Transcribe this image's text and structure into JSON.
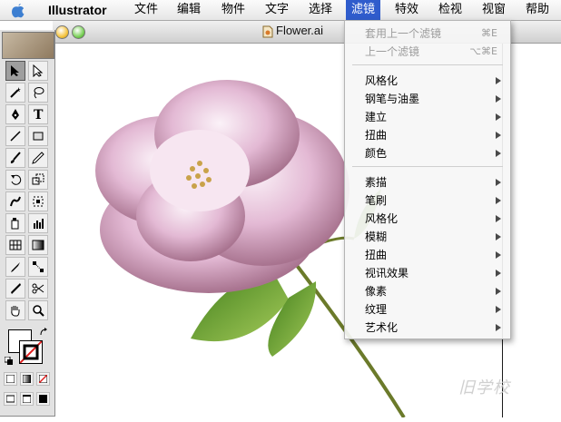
{
  "menubar": {
    "app_name": "Illustrator",
    "items": [
      "文件",
      "编辑",
      "物件",
      "文字",
      "选择",
      "滤镜",
      "特效",
      "检视",
      "视窗",
      "帮助"
    ],
    "active": "滤镜"
  },
  "document": {
    "title": "Flower.ai"
  },
  "filter_menu": {
    "top": [
      {
        "label": "套用上一个滤镜",
        "shortcut": "⌘E",
        "disabled": true
      },
      {
        "label": "上一个滤镜",
        "shortcut": "⌥⌘E",
        "disabled": true
      }
    ],
    "group1": [
      "风格化",
      "钢笔与油墨",
      "建立",
      "扭曲",
      "颜色"
    ],
    "group2": [
      "素描",
      "笔刷",
      "风格化",
      "模糊",
      "扭曲",
      "视讯效果",
      "像素",
      "纹理",
      "艺术化"
    ]
  },
  "toolbox": {
    "tools": [
      "selection-arrow",
      "direct-selection",
      "magic-wand",
      "lasso",
      "pen",
      "type",
      "line",
      "rectangle",
      "paintbrush",
      "pencil",
      "rotate",
      "scale",
      "warp",
      "free-transform",
      "symbol-sprayer",
      "graph",
      "mesh",
      "gradient",
      "eyedropper",
      "blend",
      "scissors-knife",
      "scissors",
      "hand",
      "zoom"
    ]
  },
  "colors": {
    "menu_highlight": "#2f5ccc",
    "flower_pink": "#d9a9c8",
    "leaf_green": "#5c9a2c"
  },
  "watermark": "旧学校"
}
